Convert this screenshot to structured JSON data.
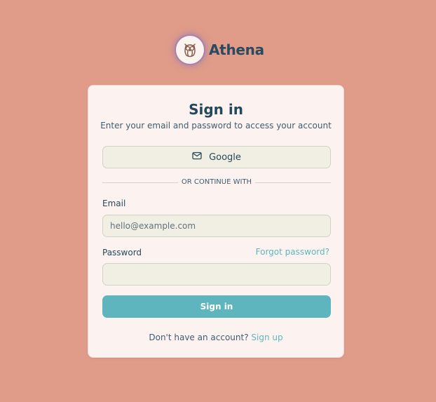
{
  "brand": {
    "name": "Athena",
    "logo_icon": "owl-icon"
  },
  "card": {
    "title": "Sign in",
    "subtitle": "Enter your email and password to access your account"
  },
  "oauth": {
    "google_label": "Google",
    "google_icon": "mail-icon"
  },
  "divider": {
    "text": "OR CONTINUE WITH"
  },
  "form": {
    "email_label": "Email",
    "email_placeholder": "hello@example.com",
    "email_value": "",
    "password_label": "Password",
    "password_value": "",
    "forgot_label": "Forgot password?",
    "submit_label": "Sign in"
  },
  "footer": {
    "prompt": "Don't have an account?",
    "signup_label": "Sign up"
  },
  "colors": {
    "background": "#e09c88",
    "card": "#fcf3f1",
    "accent": "#5fb5bd",
    "input_bg": "#f1efe3",
    "text": "#24485c"
  }
}
